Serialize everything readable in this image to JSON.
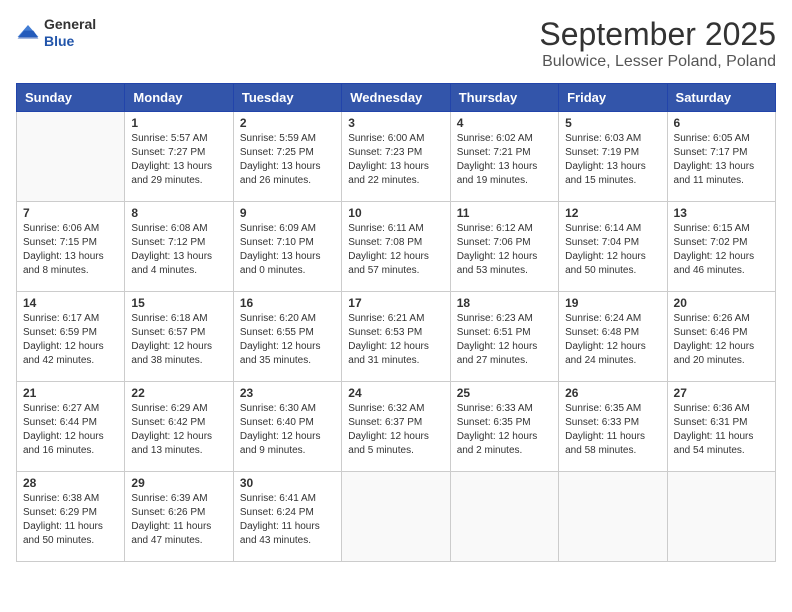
{
  "header": {
    "logo_line1": "General",
    "logo_line2": "Blue",
    "month": "September 2025",
    "location": "Bulowice, Lesser Poland, Poland"
  },
  "weekdays": [
    "Sunday",
    "Monday",
    "Tuesday",
    "Wednesday",
    "Thursday",
    "Friday",
    "Saturday"
  ],
  "weeks": [
    [
      {
        "day": "",
        "content": ""
      },
      {
        "day": "1",
        "content": "Sunrise: 5:57 AM\nSunset: 7:27 PM\nDaylight: 13 hours\nand 29 minutes."
      },
      {
        "day": "2",
        "content": "Sunrise: 5:59 AM\nSunset: 7:25 PM\nDaylight: 13 hours\nand 26 minutes."
      },
      {
        "day": "3",
        "content": "Sunrise: 6:00 AM\nSunset: 7:23 PM\nDaylight: 13 hours\nand 22 minutes."
      },
      {
        "day": "4",
        "content": "Sunrise: 6:02 AM\nSunset: 7:21 PM\nDaylight: 13 hours\nand 19 minutes."
      },
      {
        "day": "5",
        "content": "Sunrise: 6:03 AM\nSunset: 7:19 PM\nDaylight: 13 hours\nand 15 minutes."
      },
      {
        "day": "6",
        "content": "Sunrise: 6:05 AM\nSunset: 7:17 PM\nDaylight: 13 hours\nand 11 minutes."
      }
    ],
    [
      {
        "day": "7",
        "content": "Sunrise: 6:06 AM\nSunset: 7:15 PM\nDaylight: 13 hours\nand 8 minutes."
      },
      {
        "day": "8",
        "content": "Sunrise: 6:08 AM\nSunset: 7:12 PM\nDaylight: 13 hours\nand 4 minutes."
      },
      {
        "day": "9",
        "content": "Sunrise: 6:09 AM\nSunset: 7:10 PM\nDaylight: 13 hours\nand 0 minutes."
      },
      {
        "day": "10",
        "content": "Sunrise: 6:11 AM\nSunset: 7:08 PM\nDaylight: 12 hours\nand 57 minutes."
      },
      {
        "day": "11",
        "content": "Sunrise: 6:12 AM\nSunset: 7:06 PM\nDaylight: 12 hours\nand 53 minutes."
      },
      {
        "day": "12",
        "content": "Sunrise: 6:14 AM\nSunset: 7:04 PM\nDaylight: 12 hours\nand 50 minutes."
      },
      {
        "day": "13",
        "content": "Sunrise: 6:15 AM\nSunset: 7:02 PM\nDaylight: 12 hours\nand 46 minutes."
      }
    ],
    [
      {
        "day": "14",
        "content": "Sunrise: 6:17 AM\nSunset: 6:59 PM\nDaylight: 12 hours\nand 42 minutes."
      },
      {
        "day": "15",
        "content": "Sunrise: 6:18 AM\nSunset: 6:57 PM\nDaylight: 12 hours\nand 38 minutes."
      },
      {
        "day": "16",
        "content": "Sunrise: 6:20 AM\nSunset: 6:55 PM\nDaylight: 12 hours\nand 35 minutes."
      },
      {
        "day": "17",
        "content": "Sunrise: 6:21 AM\nSunset: 6:53 PM\nDaylight: 12 hours\nand 31 minutes."
      },
      {
        "day": "18",
        "content": "Sunrise: 6:23 AM\nSunset: 6:51 PM\nDaylight: 12 hours\nand 27 minutes."
      },
      {
        "day": "19",
        "content": "Sunrise: 6:24 AM\nSunset: 6:48 PM\nDaylight: 12 hours\nand 24 minutes."
      },
      {
        "day": "20",
        "content": "Sunrise: 6:26 AM\nSunset: 6:46 PM\nDaylight: 12 hours\nand 20 minutes."
      }
    ],
    [
      {
        "day": "21",
        "content": "Sunrise: 6:27 AM\nSunset: 6:44 PM\nDaylight: 12 hours\nand 16 minutes."
      },
      {
        "day": "22",
        "content": "Sunrise: 6:29 AM\nSunset: 6:42 PM\nDaylight: 12 hours\nand 13 minutes."
      },
      {
        "day": "23",
        "content": "Sunrise: 6:30 AM\nSunset: 6:40 PM\nDaylight: 12 hours\nand 9 minutes."
      },
      {
        "day": "24",
        "content": "Sunrise: 6:32 AM\nSunset: 6:37 PM\nDaylight: 12 hours\nand 5 minutes."
      },
      {
        "day": "25",
        "content": "Sunrise: 6:33 AM\nSunset: 6:35 PM\nDaylight: 12 hours\nand 2 minutes."
      },
      {
        "day": "26",
        "content": "Sunrise: 6:35 AM\nSunset: 6:33 PM\nDaylight: 11 hours\nand 58 minutes."
      },
      {
        "day": "27",
        "content": "Sunrise: 6:36 AM\nSunset: 6:31 PM\nDaylight: 11 hours\nand 54 minutes."
      }
    ],
    [
      {
        "day": "28",
        "content": "Sunrise: 6:38 AM\nSunset: 6:29 PM\nDaylight: 11 hours\nand 50 minutes."
      },
      {
        "day": "29",
        "content": "Sunrise: 6:39 AM\nSunset: 6:26 PM\nDaylight: 11 hours\nand 47 minutes."
      },
      {
        "day": "30",
        "content": "Sunrise: 6:41 AM\nSunset: 6:24 PM\nDaylight: 11 hours\nand 43 minutes."
      },
      {
        "day": "",
        "content": ""
      },
      {
        "day": "",
        "content": ""
      },
      {
        "day": "",
        "content": ""
      },
      {
        "day": "",
        "content": ""
      }
    ]
  ]
}
